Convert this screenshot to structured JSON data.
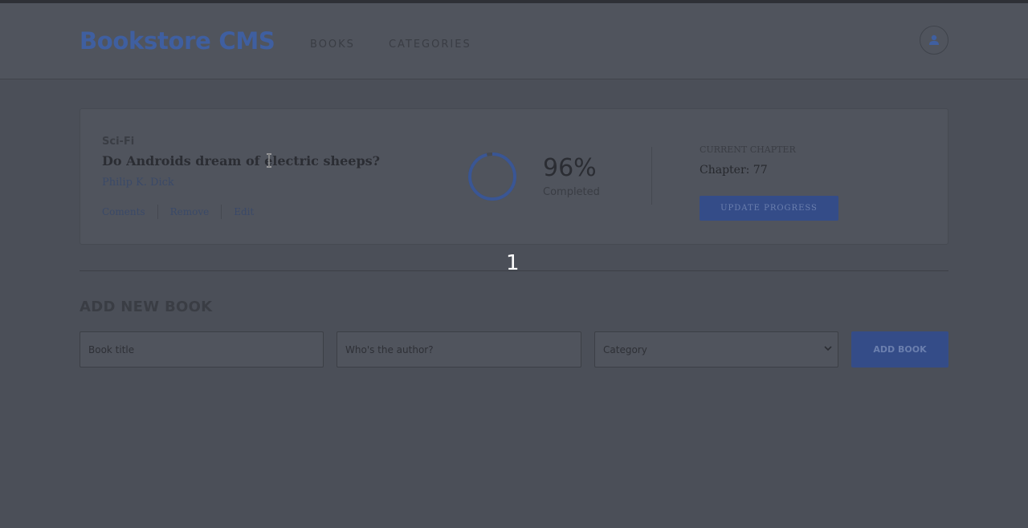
{
  "header": {
    "brand": "Bookstore CMS",
    "nav": [
      {
        "label": "BOOKS"
      },
      {
        "label": "CATEGORIES"
      }
    ],
    "user_icon": "user-icon"
  },
  "book": {
    "genre": "Sci-Fi",
    "title": "Do Androids dream of electric sheeps?",
    "author": "Philip K. Dick",
    "actions": [
      "Coments",
      "Remove",
      "Edit"
    ],
    "progress_percent": 96,
    "percent_label": "96%",
    "completed_label": "Completed",
    "chapter_label": "CURRENT CHAPTER",
    "chapter_value": "Chapter: 77",
    "update_button": "UPDATE PROGRESS"
  },
  "pagination": {
    "current": "1"
  },
  "form": {
    "heading": "ADD NEW BOOK",
    "title_placeholder": "Book title",
    "author_placeholder": "Who's the author?",
    "category_placeholder": "Category",
    "submit_label": "ADD BOOK"
  },
  "colors": {
    "accent": "#3f5fa0",
    "button": "#344c88",
    "overlay": "#4b4f58"
  }
}
